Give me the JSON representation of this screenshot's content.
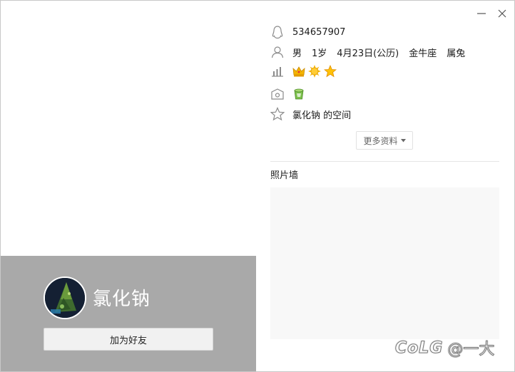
{
  "window": {
    "controls": {
      "minimize_icon": "minimize-icon",
      "close_icon": "close-icon"
    }
  },
  "profile": {
    "qq_number": "534657907",
    "gender": "男",
    "age": "1岁",
    "birthday": "4月23日(公历)",
    "zodiac": "金牛座",
    "chinese_zodiac": "属兔",
    "space_link": "氯化钠 的空间"
  },
  "left_panel": {
    "nickname": "氯化钠",
    "add_friend_label": "加为好友"
  },
  "more_info_label": "更多资料",
  "photo_wall_title": "照片墙",
  "watermark": {
    "logo": "CoLG",
    "user": "@一大"
  },
  "colors": {
    "panel_gray": "#a9a9a9",
    "icon_gray": "#8a8a8a"
  }
}
